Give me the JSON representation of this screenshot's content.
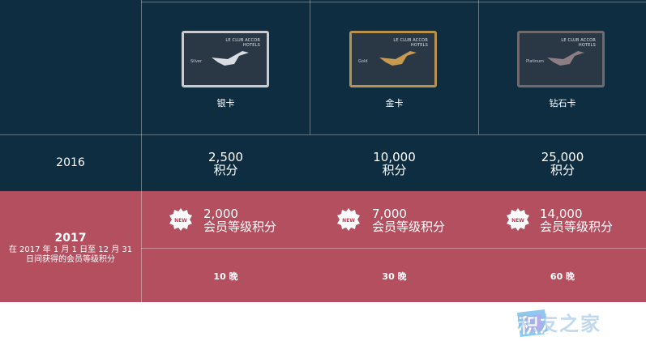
{
  "tiers": [
    {
      "label": "银卡",
      "card_tier": "Silver",
      "card_border": "#c8ccd0",
      "bird_color": "#d9dde2"
    },
    {
      "label": "金卡",
      "card_tier": "Gold",
      "card_border": "#b8924c",
      "bird_color": "#c79a4f"
    },
    {
      "label": "钻石卡",
      "card_tier": "Platinum",
      "card_border": "#6e6a6e",
      "bird_color": "#8c7e84"
    }
  ],
  "card_brand_line1": "LE CLUB ACCOR",
  "card_brand_line2": "HOTELS",
  "row_2016": {
    "year": "2016",
    "values": [
      {
        "amount": "2,500",
        "unit": "积分"
      },
      {
        "amount": "10,000",
        "unit": "积分"
      },
      {
        "amount": "25,000",
        "unit": "积分"
      }
    ]
  },
  "row_2017": {
    "year": "2017",
    "note_line1": "在 2017 年 1 月 1 日至 12 月 31",
    "note_line2": "日间获得的会员等级积分",
    "badge": "NEW",
    "values": [
      {
        "amount": "2,000",
        "unit": "会员等级积分"
      },
      {
        "amount": "7,000",
        "unit": "会员等级积分"
      },
      {
        "amount": "14,000",
        "unit": "会员等级积分"
      }
    ],
    "nights": [
      "10 晚",
      "30 晚",
      "60 晚"
    ]
  },
  "watermark": "积友之家",
  "colors": {
    "dark_bg": "#0e2d41",
    "red_bg": "#b34f5f",
    "badge_red": "#c0394f"
  }
}
